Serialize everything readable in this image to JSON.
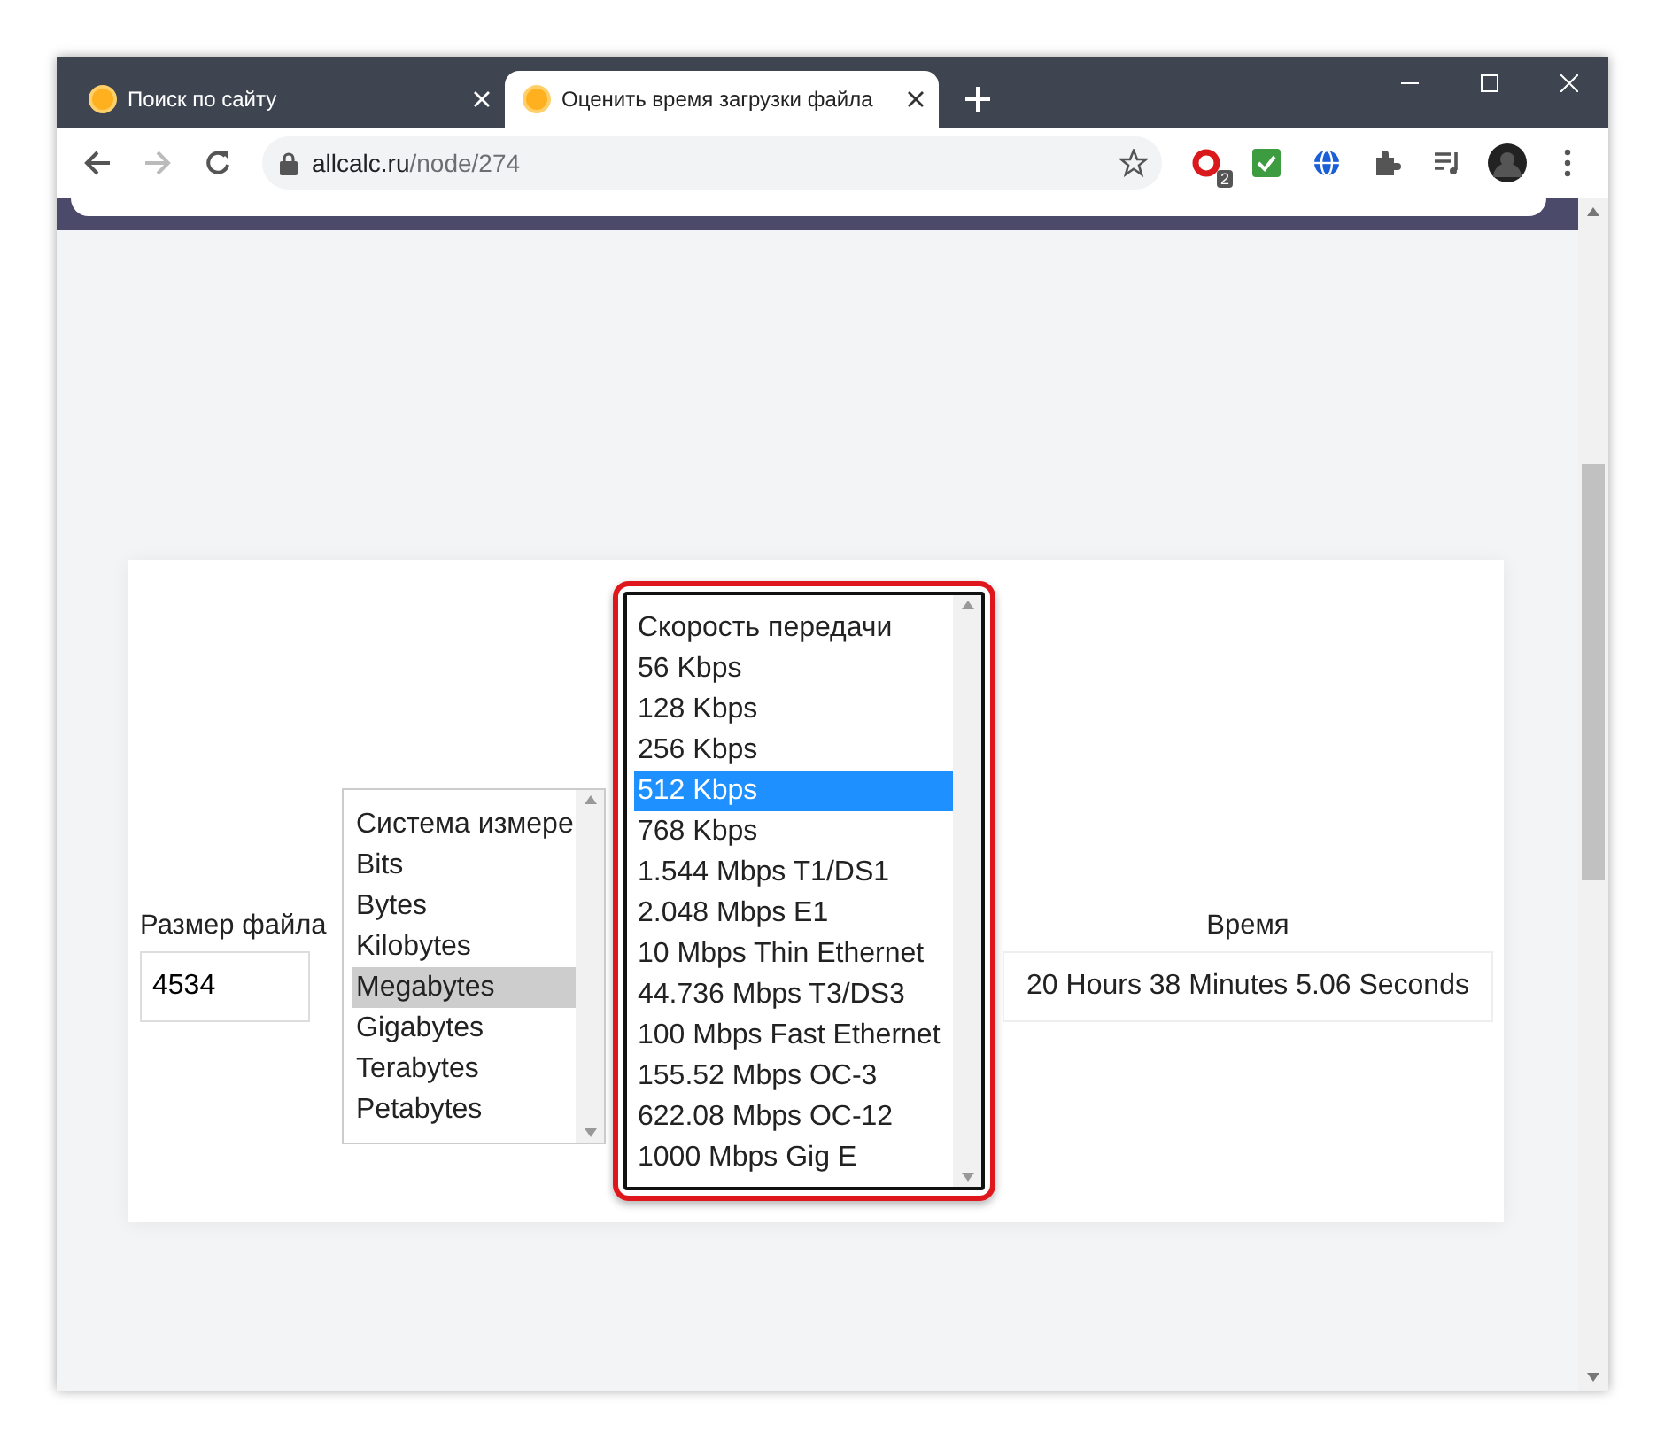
{
  "tabs": [
    {
      "title": "Поиск по сайту",
      "selected": false
    },
    {
      "title": "Оценить время загрузки файла",
      "selected": true
    }
  ],
  "address": {
    "host": "allcalc.ru",
    "path": "/node/274"
  },
  "extension_badge": "2",
  "form": {
    "size_label": "Размер файла",
    "size_value": "4534",
    "units": [
      {
        "label": "Система измере",
        "selected": false
      },
      {
        "label": "Bits",
        "selected": false
      },
      {
        "label": "Bytes",
        "selected": false
      },
      {
        "label": "Kilobytes",
        "selected": false
      },
      {
        "label": "Megabytes",
        "selected": true
      },
      {
        "label": "Gigabytes",
        "selected": false
      },
      {
        "label": "Terabytes",
        "selected": false
      },
      {
        "label": "Petabytes",
        "selected": false
      }
    ],
    "speeds": [
      {
        "label": "Скорость передачи",
        "selected": false
      },
      {
        "label": "56 Kbps",
        "selected": false
      },
      {
        "label": "128 Kbps",
        "selected": false
      },
      {
        "label": "256 Kbps",
        "selected": false
      },
      {
        "label": "512 Kbps",
        "selected": true
      },
      {
        "label": "768 Kbps",
        "selected": false
      },
      {
        "label": "1.544 Mbps T1/DS1",
        "selected": false
      },
      {
        "label": "2.048 Mbps E1",
        "selected": false
      },
      {
        "label": "10 Mbps Thin Ethernet",
        "selected": false
      },
      {
        "label": "44.736 Mbps T3/DS3",
        "selected": false
      },
      {
        "label": "100 Mbps Fast Ethernet",
        "selected": false
      },
      {
        "label": "155.52 Mbps OC-3",
        "selected": false
      },
      {
        "label": "622.08 Mbps OC-12",
        "selected": false
      },
      {
        "label": "1000 Mbps Gig E",
        "selected": false
      }
    ],
    "time_label": "Время",
    "time_value": "20 Hours 38 Minutes 5.06 Seconds"
  }
}
